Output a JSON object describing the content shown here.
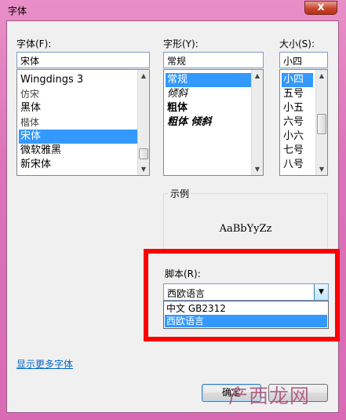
{
  "window": {
    "title": "字体",
    "close_glyph": "x"
  },
  "font": {
    "label": "字体(F):",
    "value": "宋体",
    "items": [
      "Wingdings 3",
      "仿宋",
      "黑体",
      "楷体",
      "宋体",
      "微软雅黑",
      "新宋体"
    ],
    "selected_index": 4
  },
  "style": {
    "label": "字形(Y):",
    "value": "常规",
    "items": [
      "常规",
      "倾斜",
      "粗体",
      "粗体 倾斜"
    ],
    "selected_index": 0
  },
  "size": {
    "label": "大小(S):",
    "value": "小四",
    "items": [
      "小四",
      "五号",
      "小五",
      "六号",
      "小六",
      "七号",
      "八号"
    ],
    "selected_index": 0
  },
  "sample": {
    "label": "示例",
    "text": "AaBbYyZz"
  },
  "script": {
    "label": "脚本(R):",
    "value": "西欧语言",
    "options": [
      "中文 GB2312",
      "西欧语言"
    ],
    "selected_index": 1
  },
  "more_fonts_link": "显示更多字体",
  "buttons": {
    "ok": "确定",
    "cancel": ""
  },
  "watermark": "产西龙网",
  "colors": {
    "selection": "#3399ff",
    "highlight_box": "#ff0000",
    "link": "#0066cc"
  }
}
